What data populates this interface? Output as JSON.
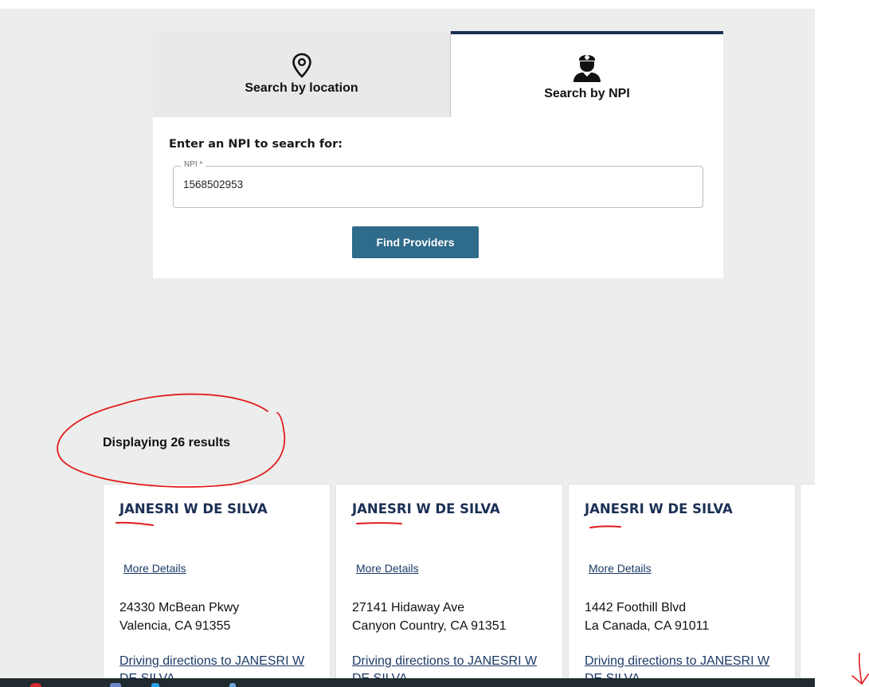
{
  "tabs": [
    {
      "label": "Search by location",
      "icon": "map-pin-icon",
      "active": false
    },
    {
      "label": "Search by NPI",
      "icon": "doctor-icon",
      "active": true
    }
  ],
  "form": {
    "prompt": "Enter an NPI to search for:",
    "field_label": "NPI *",
    "value": "1568502953",
    "button": "Find Providers"
  },
  "results": {
    "summary": "Displaying 26 results",
    "cards": [
      {
        "name": "JANESRI W DE SILVA",
        "details_link": "More Details",
        "address_line1": "24330 McBean Pkwy",
        "address_line2": "Valencia, CA 91355",
        "directions": "Driving directions to JANESRI W DE SILVA"
      },
      {
        "name": "JANESRI W DE SILVA",
        "details_link": "More Details",
        "address_line1": "27141 Hidaway Ave",
        "address_line2": "Canyon Country, CA 91351",
        "directions": "Driving directions to JANESRI W DE SILVA"
      },
      {
        "name": "JANESRI W DE SILVA",
        "details_link": "More Details",
        "address_line1": "1442 Foothill Blvd",
        "address_line2": "La Canada, CA 91011",
        "directions": "Driving directions to JANESRI W DE SILVA"
      }
    ]
  },
  "colors": {
    "accent_navy": "#1b2f55",
    "button": "#2f6b8a",
    "annotation_red": "#e11c1c",
    "page_bg": "#eceded"
  }
}
